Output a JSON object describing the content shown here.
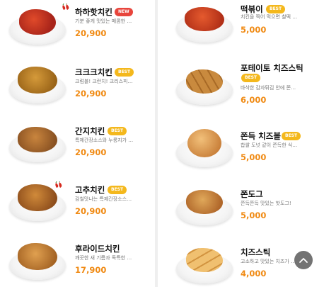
{
  "left_menu": [
    {
      "title": "하하핫치킨",
      "badge": "NEW",
      "desc": "기분 좋게 맛있는 매콤한 …",
      "price": "20,900",
      "spicy": true
    },
    {
      "title": "크크크치킨",
      "badge": "BEST",
      "desc": "크럼블! 크런치! 크리스피! …",
      "price": "20,900",
      "spicy": false
    },
    {
      "title": "간지치킨",
      "badge": "BEST",
      "desc": "특제간장소스와 누룽지가 …",
      "price": "20,900",
      "spicy": false
    },
    {
      "title": "고추치킨",
      "badge": "BEST",
      "desc": "감칠맛나는 특제간장소스…",
      "price": "20,900",
      "spicy": true
    },
    {
      "title": "후라이드치킨",
      "badge": "",
      "desc": "깨끗한 새 기름과 독특한 …",
      "price": "17,900",
      "spicy": false
    }
  ],
  "right_menu": [
    {
      "title": "떡볶이",
      "badge": "BEST",
      "desc": "치킨을 찍어 먹으면 찰떡 …",
      "price": "5,000"
    },
    {
      "title": "포테이토 치즈스틱",
      "badge": "BEST",
      "desc": "바삭한 감자튀김 안에 쫀득…",
      "price": "6,000"
    },
    {
      "title": "쫀득 치즈볼",
      "badge": "BEST",
      "desc": "찹쌀 도넛 같이 쫀득한 식…",
      "price": "5,000"
    },
    {
      "title": "쫀도그",
      "badge": "",
      "desc": "쫀득쫀득 맛있는 핫도그!",
      "price": "5,000"
    },
    {
      "title": "치즈스틱",
      "badge": "",
      "desc": "고소하고 맛있는 치즈가 가…",
      "price": "4,000"
    }
  ],
  "colors": {
    "price": "#f08a13",
    "new_badge": "#e8453c",
    "best_badge": "#f4b81c"
  },
  "icons": {
    "scroll_top": "chevron-up-icon",
    "spicy": "chili-pepper-icon"
  }
}
